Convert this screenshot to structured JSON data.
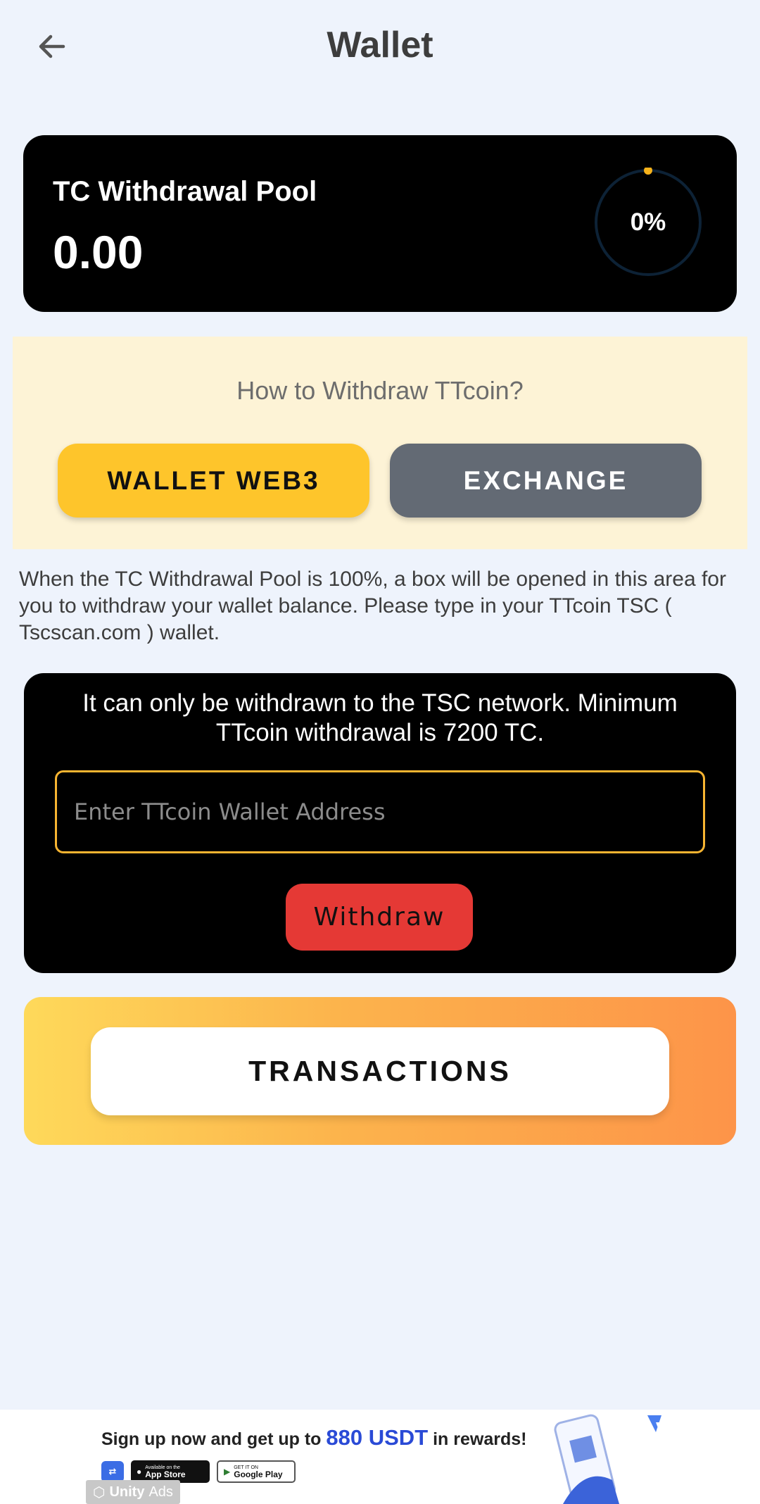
{
  "header": {
    "title": "Wallet",
    "back_icon": "arrow-left-icon"
  },
  "pool": {
    "label": "TC Withdrawal Pool",
    "amount": "0.00",
    "progress_text": "0%",
    "progress_fraction": 0,
    "ring_color": "#0d2236",
    "dot_color": "#f6b21b"
  },
  "howto": {
    "title": "How to Withdraw TTcoin?",
    "wallet_web3_label": "WALLET WEB3",
    "exchange_label": "EXCHANGE"
  },
  "info_text": "When the TC Withdrawal Pool is 100%, a box will be opened in this area for you to withdraw your wallet balance. Please type in your TTcoin TSC ( Tscscan.com ) wallet.",
  "withdraw": {
    "note": "It can only be withdrawn to the TSC network. Minimum TTcoin withdrawal is 7200 TC.",
    "input_placeholder": "Enter TTcoin Wallet Address",
    "input_value": "",
    "button_label": "Withdraw"
  },
  "transactions": {
    "label": "TRANSACTIONS"
  },
  "ad": {
    "headline_pre": "Sign up now and get up to",
    "headline_highlight": "880 USDT",
    "headline_post": "in rewards!",
    "app_store_small": "Available on the",
    "app_store": "App Store",
    "google_play_small": "GET IT ON",
    "google_play": "Google Play",
    "provider": "Unity",
    "provider_suffix": "Ads"
  },
  "colors": {
    "background": "#eef3fc",
    "accent_yellow": "#fec52b",
    "withdraw_red": "#e53935",
    "exchange_gray": "#636a74"
  }
}
